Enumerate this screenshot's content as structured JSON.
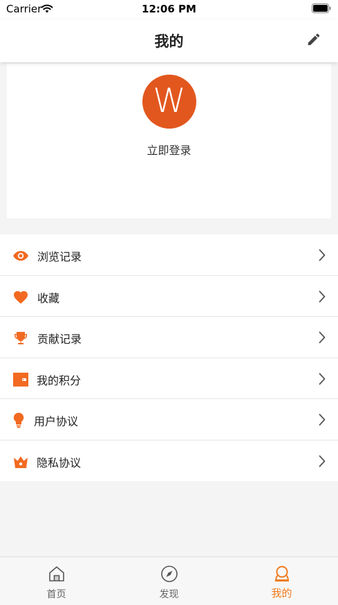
{
  "status_bar": {
    "carrier": "Carrier",
    "time": "12:06 PM"
  },
  "nav": {
    "title": "我的",
    "edit_icon": "pencil-icon"
  },
  "profile": {
    "avatar_letter": "W",
    "avatar_color": "#e2571e",
    "login_label": "立即登录"
  },
  "menu": {
    "items": [
      {
        "label": "浏览记录",
        "icon": "eye-icon"
      },
      {
        "label": "收藏",
        "icon": "heart-icon"
      },
      {
        "label": "贡献记录",
        "icon": "trophy-icon"
      },
      {
        "label": "我的积分",
        "icon": "wallet-icon"
      },
      {
        "label": "用户协议",
        "icon": "lightbulb-icon"
      },
      {
        "label": "隐私协议",
        "icon": "crown-icon"
      }
    ]
  },
  "tabs": [
    {
      "label": "首页",
      "icon": "home-icon",
      "active": false
    },
    {
      "label": "发现",
      "icon": "compass-icon",
      "active": false
    },
    {
      "label": "我的",
      "icon": "user-icon",
      "active": true
    }
  ],
  "colors": {
    "accent": "#f07b1e",
    "menu_icon": "#f26a21",
    "background": "#f4f4f4"
  }
}
